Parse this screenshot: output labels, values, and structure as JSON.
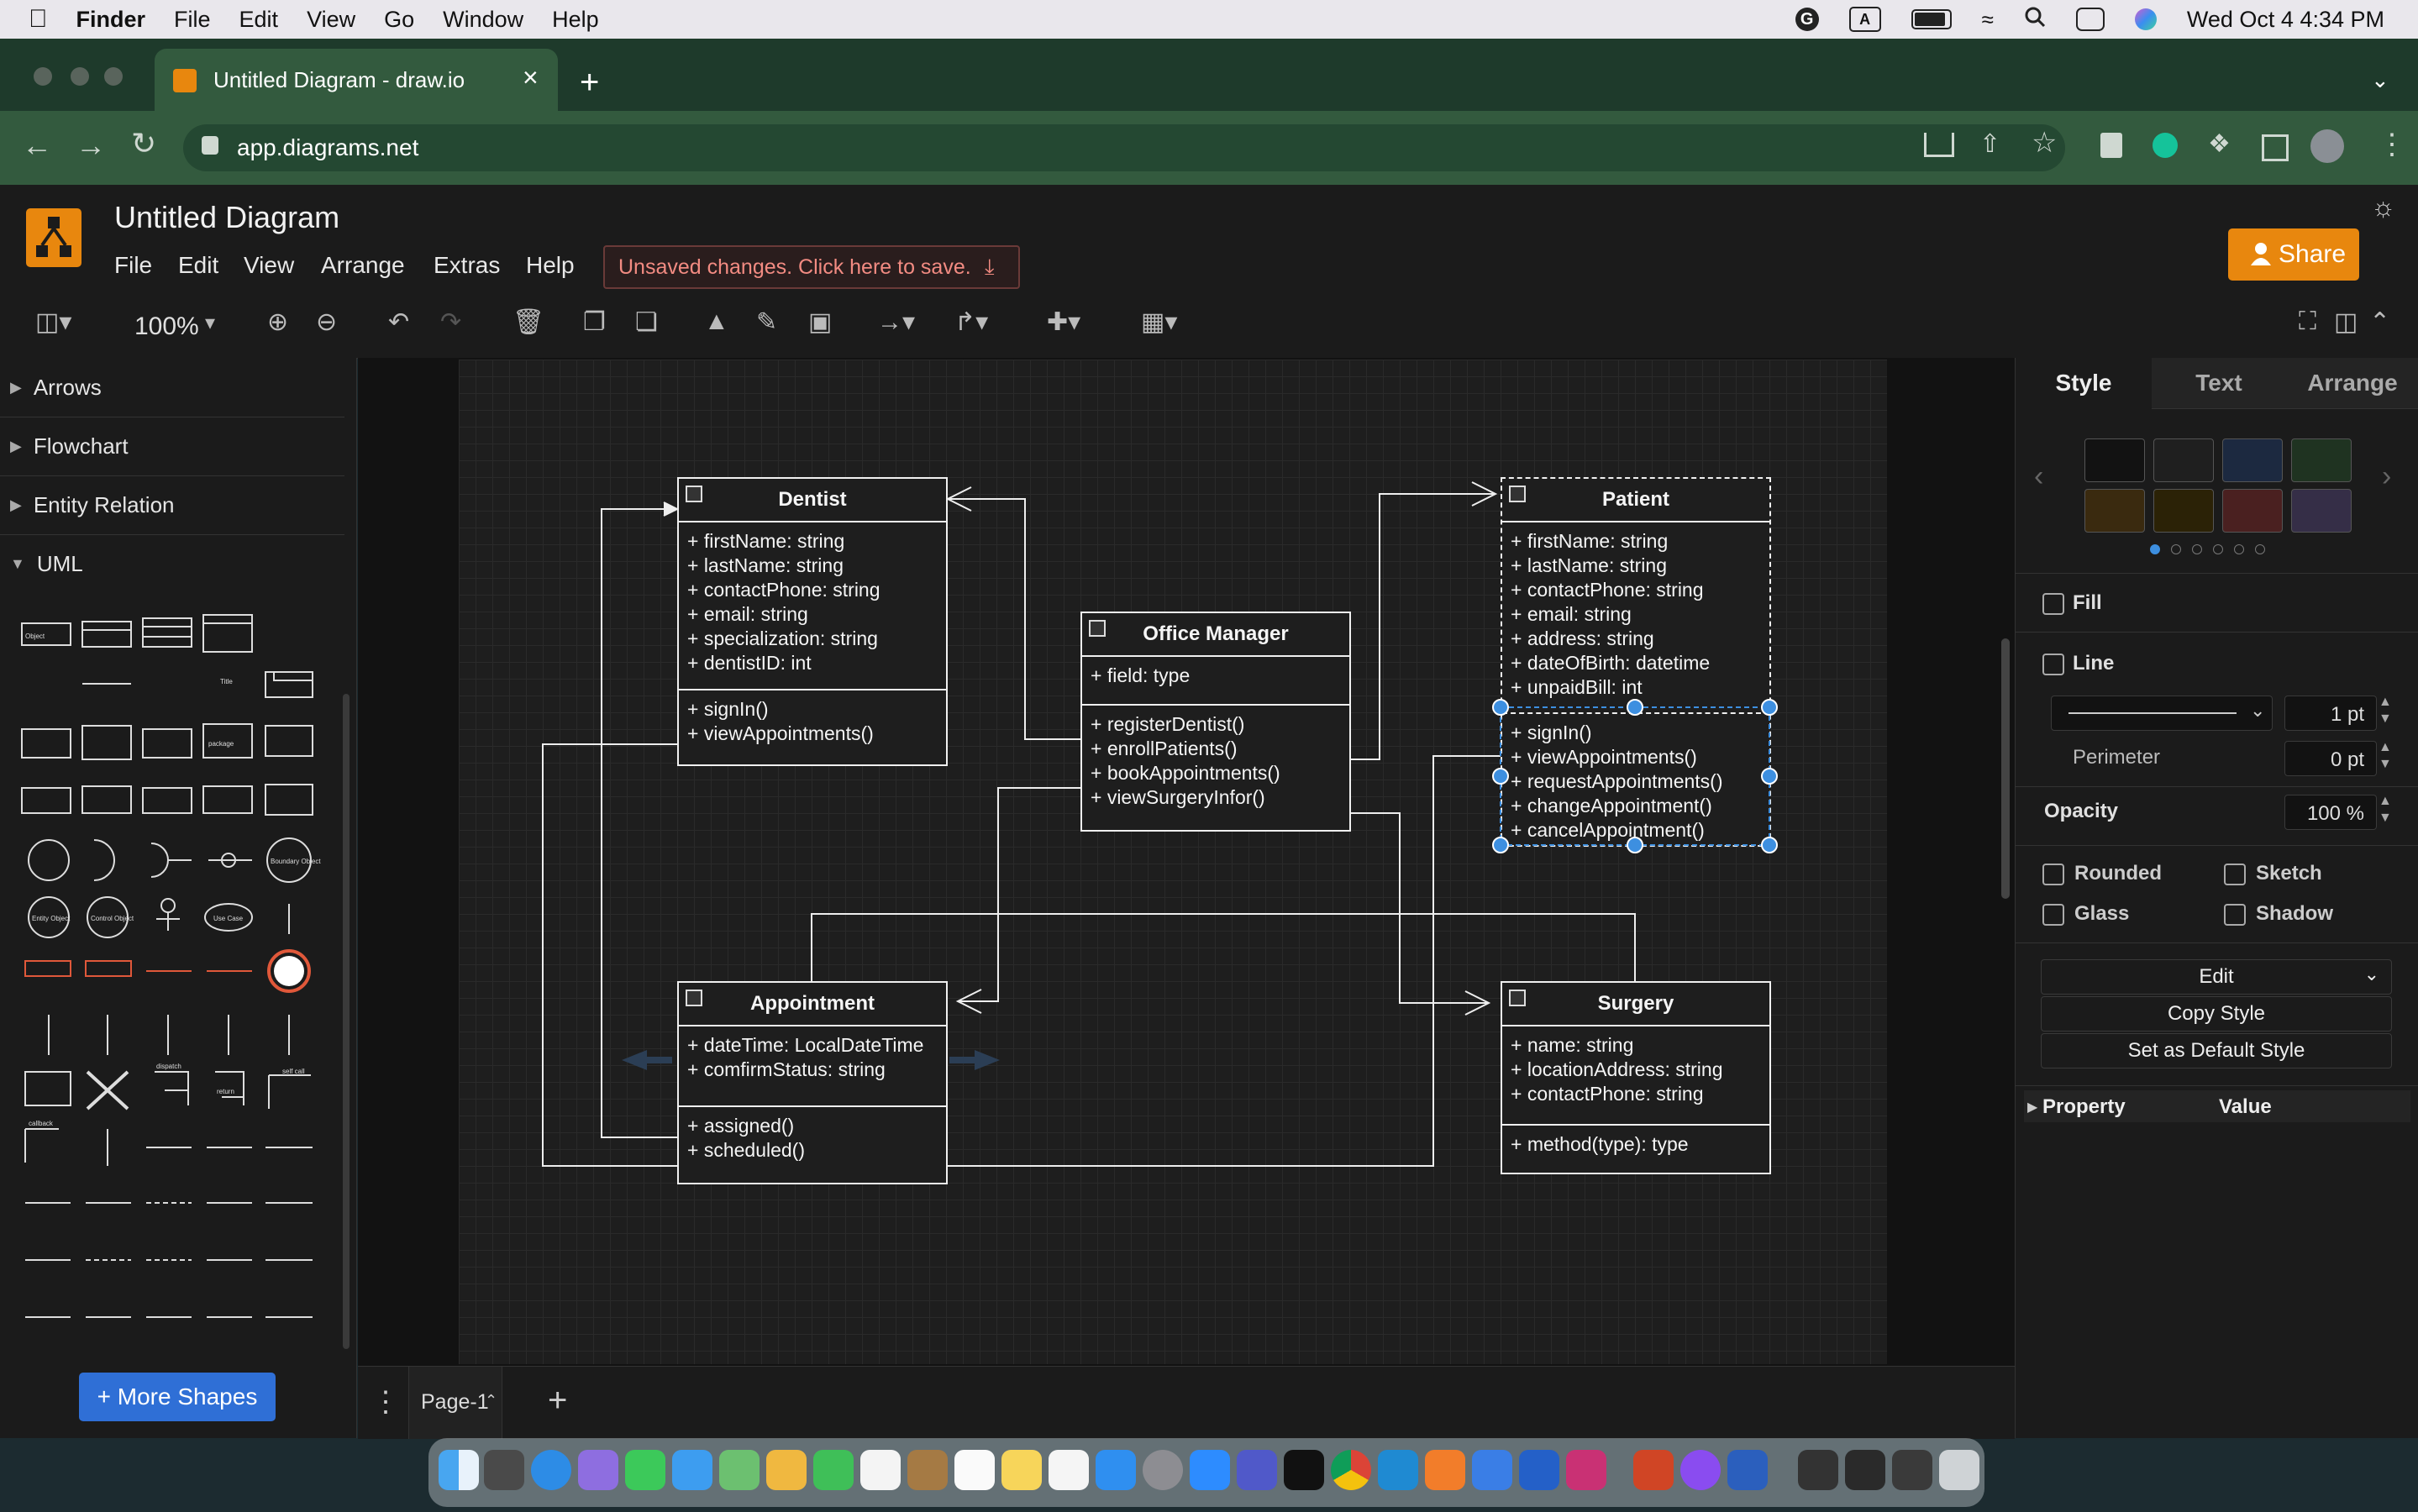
{
  "macos_menubar": {
    "app_name": "Finder",
    "menus": [
      "File",
      "Edit",
      "View",
      "Go",
      "Window",
      "Help"
    ],
    "input_source": "A",
    "datetime": "Wed Oct 4  4:34 PM"
  },
  "browser": {
    "tab_title": "Untitled Diagram - draw.io",
    "url": "app.diagrams.net"
  },
  "app": {
    "title": "Untitled Diagram",
    "menus": [
      "File",
      "Edit",
      "View",
      "Arrange",
      "Extras",
      "Help"
    ],
    "unsaved_banner": "Unsaved changes. Click here to save.",
    "share_label": "Share",
    "zoom": "100%"
  },
  "sidebar": {
    "sections": [
      {
        "label": "Arrows",
        "expanded": false
      },
      {
        "label": "Flowchart",
        "expanded": false
      },
      {
        "label": "Entity Relation",
        "expanded": false
      },
      {
        "label": "UML",
        "expanded": true
      }
    ],
    "thumb_labels": [
      "Object",
      "Title",
      "package",
      "Entity Object",
      "Control Object",
      "Use Case",
      "Boundary Object",
      "dispatch",
      "return",
      "self call",
      "callback"
    ],
    "more_shapes_label": "+ More Shapes"
  },
  "pages": {
    "current": "Page-1"
  },
  "format_panel": {
    "tabs": [
      "Style",
      "Text",
      "Arrange"
    ],
    "active_tab": "Style",
    "swatches_row1": [
      "#121212",
      "#1f1f1f",
      "#1c2940",
      "#1f3321"
    ],
    "swatches_row2": [
      "#3a2a0f",
      "#2b2206",
      "#4a2020",
      "#352e47"
    ],
    "fill_label": "Fill",
    "line_label": "Line",
    "line_width": "1 pt",
    "perimeter_label": "Perimeter",
    "perimeter_value": "0 pt",
    "opacity_label": "Opacity",
    "opacity_value": "100 %",
    "rounded_label": "Rounded",
    "sketch_label": "Sketch",
    "glass_label": "Glass",
    "shadow_label": "Shadow",
    "edit_label": "Edit",
    "copy_style_label": "Copy Style",
    "default_style_label": "Set as Default Style",
    "property_header": "Property",
    "value_header": "Value"
  },
  "diagram": {
    "classes": {
      "dentist": {
        "name": "Dentist",
        "attributes": [
          "+ firstName: string",
          "+ lastName: string",
          "+ contactPhone: string",
          "+ email: string",
          "+ specialization: string",
          "+ dentistID: int"
        ],
        "methods": [
          "+ signIn()",
          "+ viewAppointments()"
        ]
      },
      "office_manager": {
        "name": "Office Manager",
        "attributes": [
          "+ field: type"
        ],
        "methods": [
          "+ registerDentist()",
          "+ enrollPatients()",
          "+ bookAppointments()",
          "+ viewSurgeryInfor()"
        ]
      },
      "patient": {
        "name": "Patient",
        "attributes": [
          "+ firstName: string",
          "+ lastName: string",
          "+ contactPhone: string",
          "+ email: string",
          "+ address: string",
          "+ dateOfBirth: datetime",
          "+ unpaidBill: int"
        ],
        "methods": [
          "+ signIn()",
          "+ viewAppointments()",
          "+ requestAppointments()",
          "+ changeAppointment()",
          "+ cancelAppointment()"
        ]
      },
      "appointment": {
        "name": "Appointment",
        "attributes": [
          "+ dateTime: LocalDateTime",
          "+ comfirmStatus: string"
        ],
        "methods": [
          "+ assigned()",
          "+ scheduled()"
        ]
      },
      "surgery": {
        "name": "Surgery",
        "attributes": [
          "+ name: string",
          "+ locationAddress: string",
          "+ contactPhone: string"
        ],
        "methods": [
          "+ method(type): type"
        ]
      }
    }
  },
  "colors": {
    "accent_orange": "#e8870e",
    "brand_blue": "#2f6fd6",
    "selection_blue": "#3d8fe0",
    "unsaved_text": "#f28b82"
  }
}
